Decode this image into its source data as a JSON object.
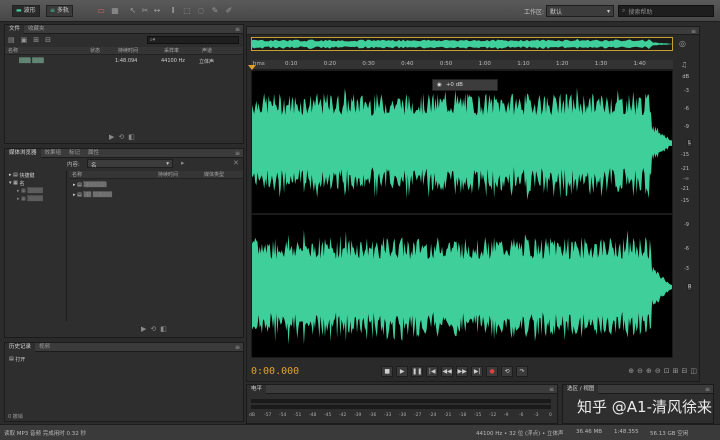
{
  "toolbar": {
    "waveform_label": "波形",
    "multitrack_label": "多轨",
    "workspace_label": "工作区:",
    "workspace_value": "默认",
    "search_placeholder": "搜索帮助"
  },
  "files_panel": {
    "tabs": [
      "文件",
      "收藏夹"
    ],
    "columns": [
      "名称",
      "状态",
      "持续时间",
      "采样率",
      "声道"
    ],
    "rows": [
      {
        "name": "▒▒▒ ▒▒▒",
        "status": "",
        "duration": "1:48.094",
        "sample_rate": "44100 Hz",
        "channels": "立体声"
      }
    ]
  },
  "media_panel": {
    "tabs": [
      "媒体浏览器",
      "效果组",
      "标记",
      "属性"
    ],
    "content_label": "内容:",
    "content_value": "名",
    "columns": [
      "名称",
      "持续时间",
      "媒体类型"
    ],
    "tree": [
      "快捷键",
      "名"
    ],
    "list_items": [
      "▒▒▒▒▒▒",
      "▒▒ ▒▒▒▒▒"
    ]
  },
  "history_panel": {
    "tabs": [
      "历史记录",
      "视频"
    ],
    "items": [
      "打开"
    ],
    "footer": "0 撤销"
  },
  "editor": {
    "ruler_unit": "hms",
    "ruler_labels": [
      "0:10",
      "0:20",
      "0:30",
      "0:40",
      "0:50",
      "1:00",
      "1:10",
      "1:20",
      "1:30",
      "1:40"
    ],
    "hud_value": "+0 dB",
    "db_scale": [
      "dB",
      "-3",
      "-6",
      "-9",
      "-15",
      "-21",
      "-∞",
      "-21",
      "-15",
      "-9",
      "-6",
      "-3"
    ],
    "channels": [
      "L",
      "R"
    ],
    "timecode": "0:00.000",
    "waveform_color": "#3fcf9a"
  },
  "levels_panel": {
    "tabs": [
      "电平"
    ],
    "scale": [
      "dB",
      "-57",
      "-54",
      "-51",
      "-48",
      "-45",
      "-42",
      "-39",
      "-36",
      "-33",
      "-30",
      "-27",
      "-24",
      "-21",
      "-18",
      "-15",
      "-12",
      "-9",
      "-6",
      "-3",
      "0"
    ]
  },
  "selection_panel": {
    "tabs": [
      "选区 / 视图"
    ]
  },
  "status": {
    "left": "读取 MP3 音频 完成用时 0.32 秒",
    "sample": "44100 Hz • 32 位 (浮点) • 立体声",
    "size": "36.46 MB",
    "duration": "1:48.355",
    "free": "56.13 GB 空闲"
  },
  "watermark": "知乎 @A1-清风徐来"
}
